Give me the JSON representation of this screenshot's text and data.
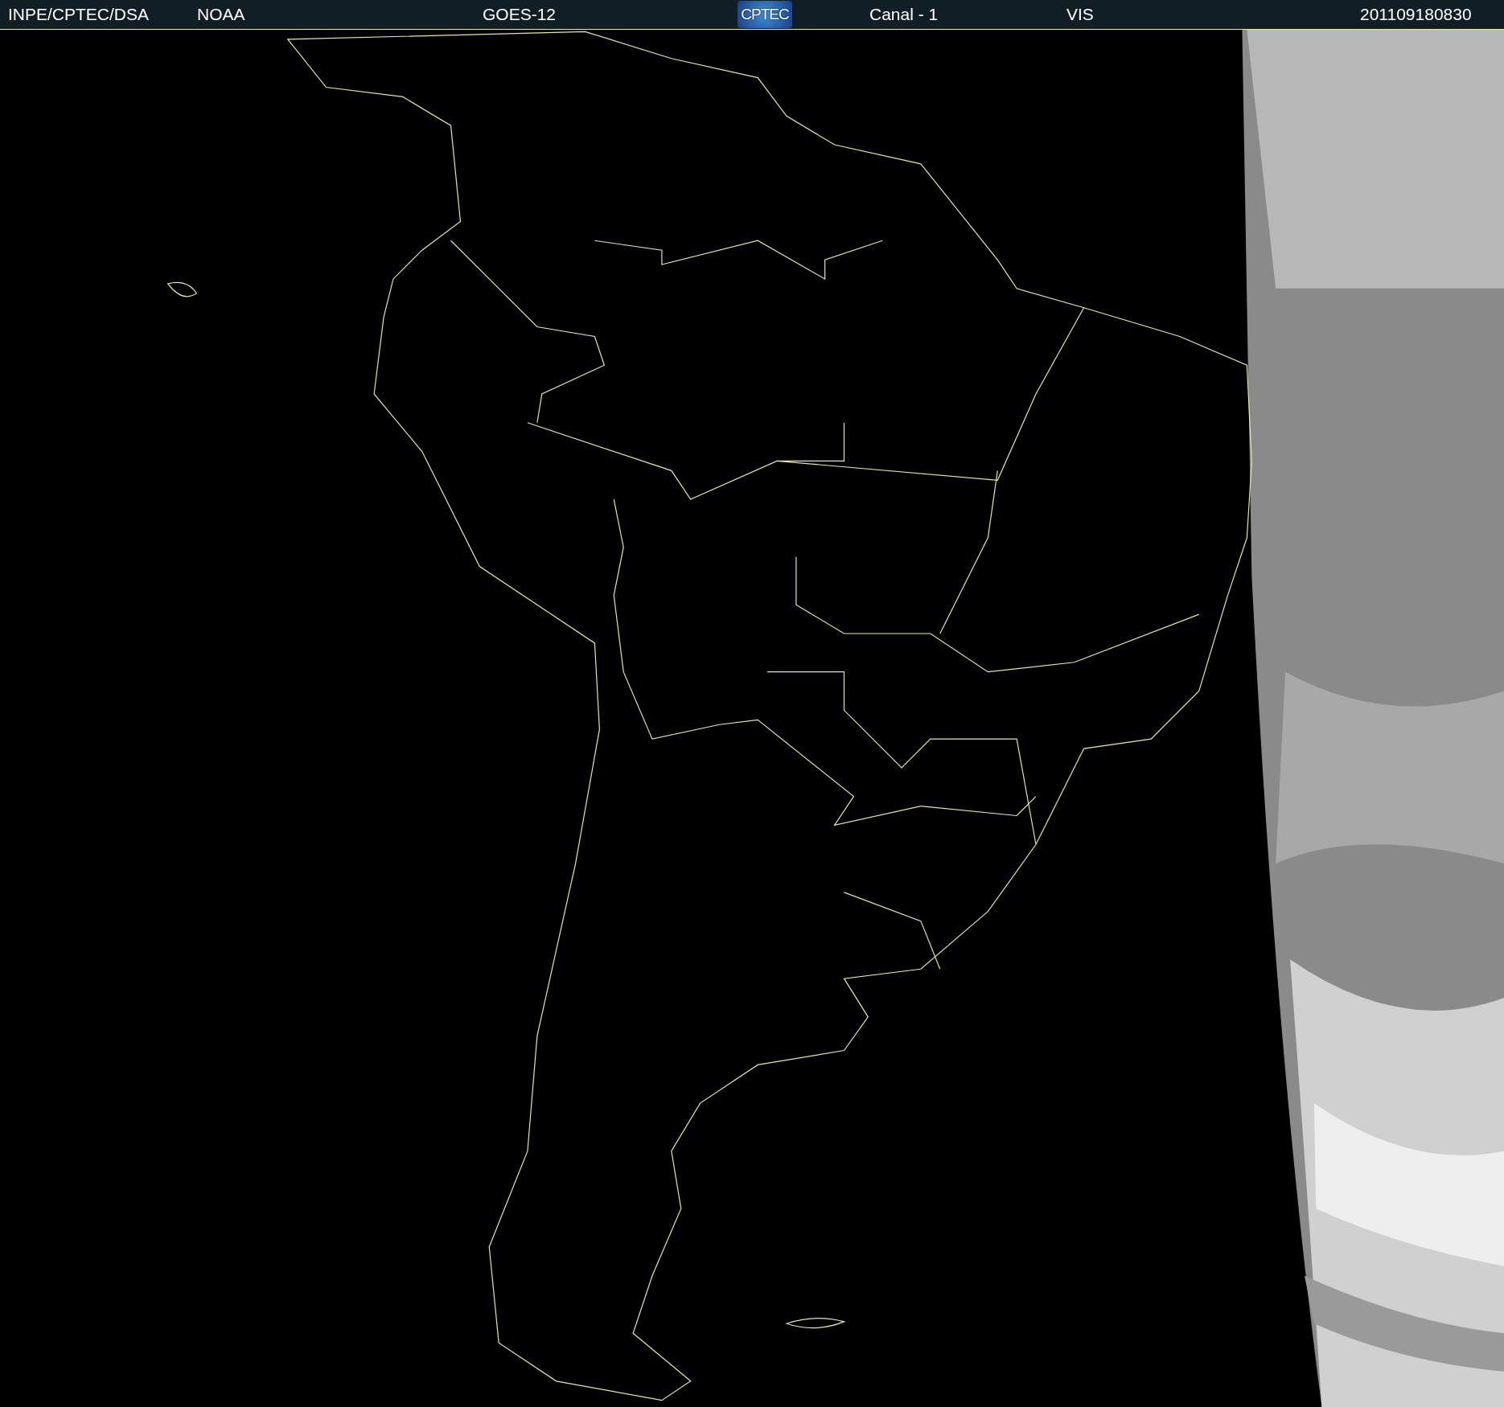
{
  "header": {
    "items": [
      {
        "kind": "text",
        "text": "INPE/CPTEC/DSA"
      },
      {
        "kind": "text",
        "text": "NOAA"
      },
      {
        "kind": "text",
        "text": "GOES-12"
      },
      {
        "kind": "logo",
        "text": "CPTEC"
      },
      {
        "kind": "text",
        "text": "Canal - 1"
      },
      {
        "kind": "text",
        "text": "VIS"
      },
      {
        "kind": "text",
        "text": "201109180830"
      }
    ]
  }
}
